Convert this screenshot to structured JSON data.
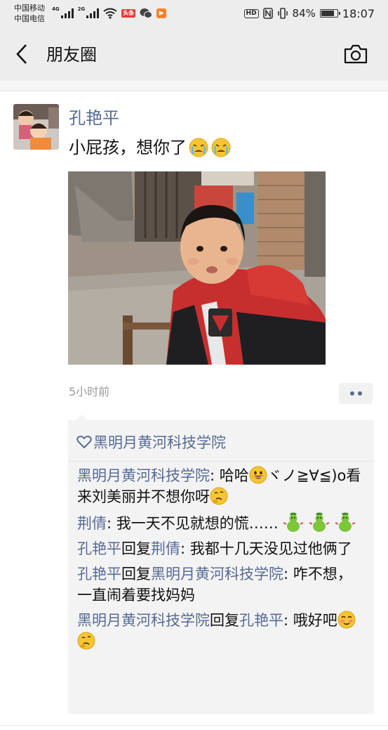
{
  "status_bar": {
    "carrier_1": "中国移动",
    "carrier_2": "中国电信",
    "net_1": "4G",
    "net_2": "2G",
    "toutiao_badge": "头条",
    "hd_label": "HD",
    "battery_level": "84%",
    "battery_fraction": 0.84,
    "time": "18:07",
    "icons": [
      "signal-icon",
      "wifi-icon",
      "toutiao-icon",
      "wechat-icon",
      "video-app-icon",
      "nfc-icon",
      "vibrate-icon",
      "battery-icon"
    ]
  },
  "navbar": {
    "title": "朋友圈",
    "back_icon": "chevron-left-icon",
    "camera_icon": "camera-icon"
  },
  "post": {
    "author": "孔艳平",
    "text": "小屁孩，想你了",
    "text_emojis": [
      "crying-face-emoji",
      "crying-face-emoji"
    ],
    "photo": "photo-child-in-red-jacket",
    "time": "5小时前"
  },
  "likes": {
    "icon": "heart-outline-icon",
    "names": "黑明月黄河科技学院"
  },
  "comments": [
    {
      "author": "黑明月黄河科技学院",
      "reply_word": "",
      "reply_to": "",
      "text_a": ": 哈哈",
      "text_b": "ヾノ≧∀≦)o看来刘美丽并不想你呀"
    },
    {
      "author": "荆倩",
      "reply_word": "",
      "reply_to": "",
      "text_a": ": 我一天不见就想的慌……",
      "text_b": ""
    },
    {
      "author": "孔艳平",
      "reply_word": "回复",
      "reply_to": "荆倩",
      "text_a": ": 我都十几天没见过他俩了",
      "text_b": ""
    },
    {
      "author": "孔艳平",
      "reply_word": "回复",
      "reply_to": "黑明月黄河科技学院",
      "text_a": ": 咋不想，一直闹着要找妈妈",
      "text_b": ""
    },
    {
      "author": "黑明月黄河科技学院",
      "reply_word": "回复",
      "reply_to": "孔艳平",
      "text_a": ": 哦好吧",
      "text_b": ""
    }
  ],
  "colors": {
    "nickname": "#576b95",
    "header_bg": "#ededed",
    "comment_bg": "#f3f3f3",
    "timestamp": "#9a9a9a"
  }
}
